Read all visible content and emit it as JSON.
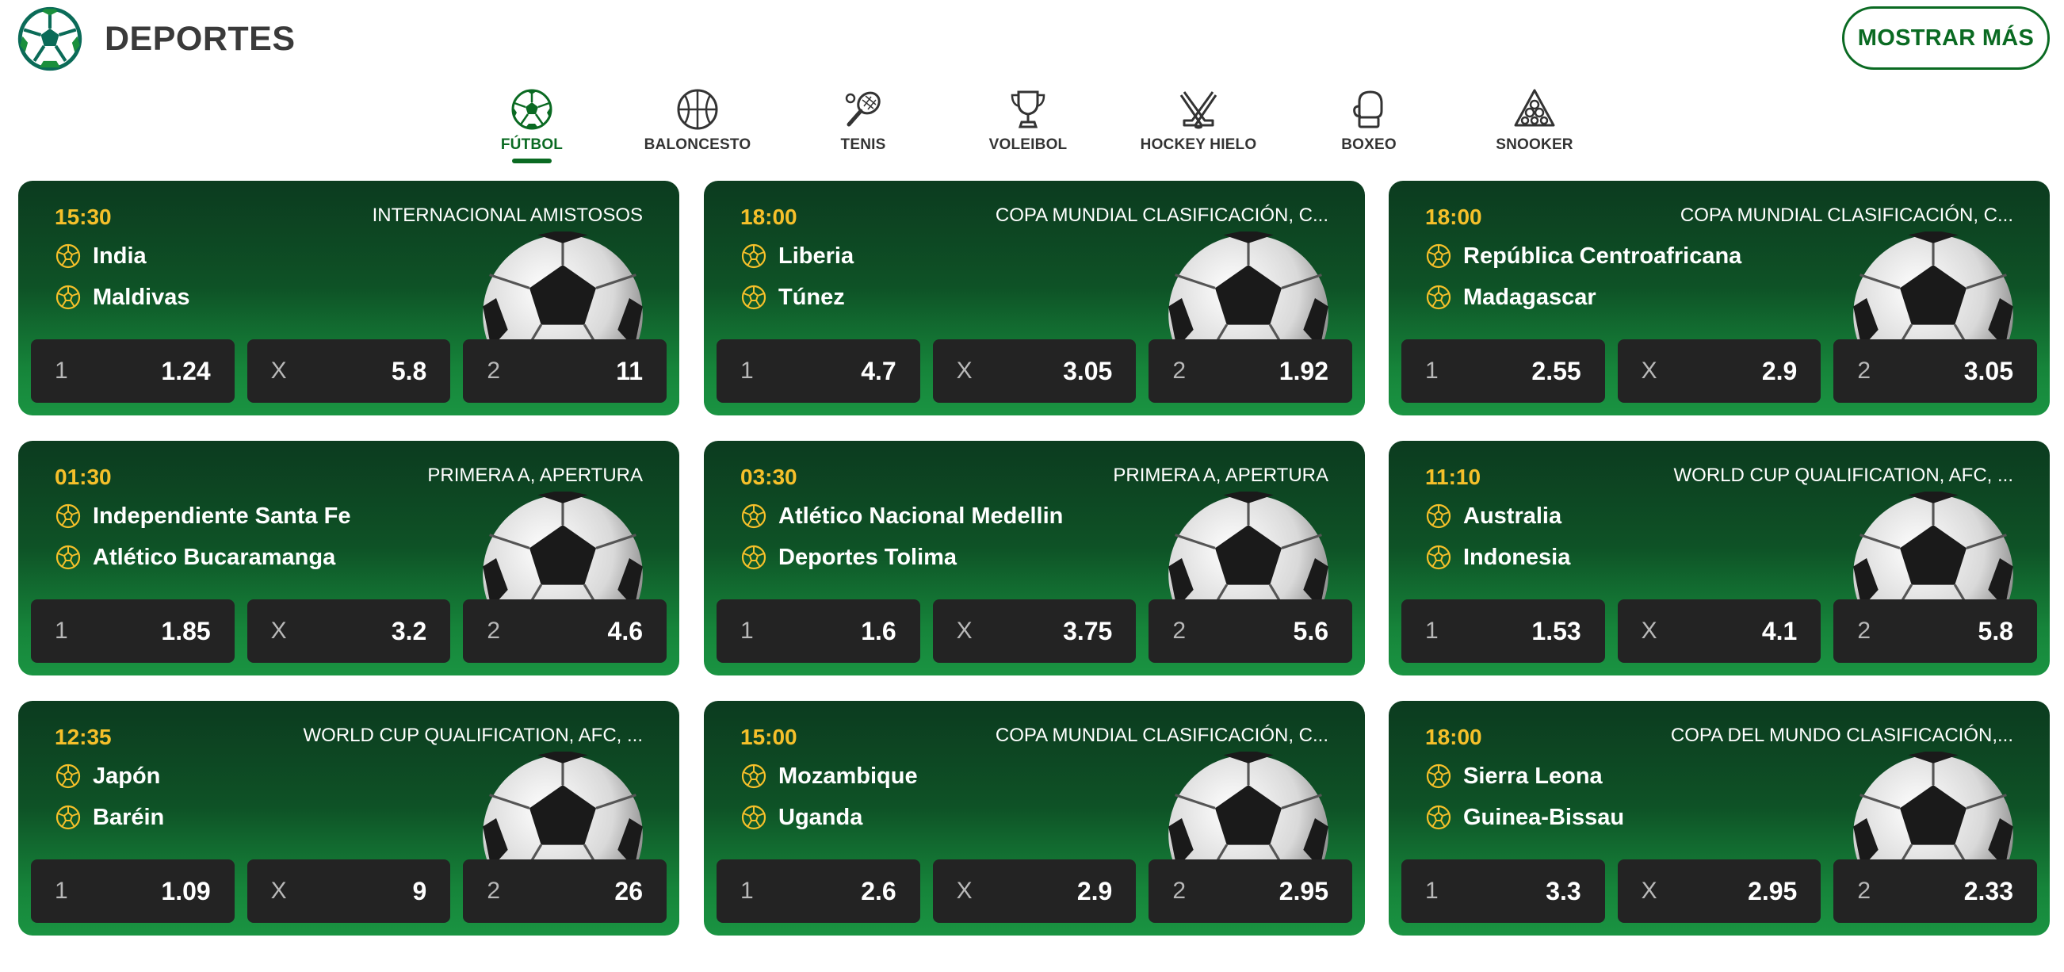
{
  "header": {
    "title": "DEPORTES",
    "more_button": "MOSTRAR MÁS",
    "logo_icon": "soccer-ball-icon"
  },
  "colors": {
    "brand_green": "#0a6a22",
    "time_yellow": "#f5c02a",
    "odds_bg": "#232323"
  },
  "tabs": [
    {
      "label": "FÚTBOL",
      "icon": "soccer-ball-icon",
      "active": true
    },
    {
      "label": "BALONCESTO",
      "icon": "basketball-icon",
      "active": false
    },
    {
      "label": "TENIS",
      "icon": "tennis-racket-icon",
      "active": false
    },
    {
      "label": "VOLEIBOL",
      "icon": "trophy-icon",
      "active": false
    },
    {
      "label": "HOCKEY HIELO",
      "icon": "hockey-sticks-icon",
      "active": false
    },
    {
      "label": "BOXEO",
      "icon": "boxing-glove-icon",
      "active": false
    },
    {
      "label": "SNOOKER",
      "icon": "snooker-balls-icon",
      "active": false
    }
  ],
  "events": [
    {
      "time": "15:30",
      "league": "INTERNACIONAL AMISTOSOS",
      "home": "India",
      "away": "Maldivas",
      "odds": [
        {
          "sel": "1",
          "val": "1.24"
        },
        {
          "sel": "X",
          "val": "5.8"
        },
        {
          "sel": "2",
          "val": "11"
        }
      ]
    },
    {
      "time": "18:00",
      "league": "COPA MUNDIAL CLASIFICACIÓN, C...",
      "home": "Liberia",
      "away": "Túnez",
      "odds": [
        {
          "sel": "1",
          "val": "4.7"
        },
        {
          "sel": "X",
          "val": "3.05"
        },
        {
          "sel": "2",
          "val": "1.92"
        }
      ]
    },
    {
      "time": "18:00",
      "league": "COPA MUNDIAL CLASIFICACIÓN, C...",
      "home": "República Centroafricana",
      "away": "Madagascar",
      "odds": [
        {
          "sel": "1",
          "val": "2.55"
        },
        {
          "sel": "X",
          "val": "2.9"
        },
        {
          "sel": "2",
          "val": "3.05"
        }
      ]
    },
    {
      "time": "01:30",
      "league": "PRIMERA A, APERTURA",
      "home": "Independiente Santa Fe",
      "away": "Atlético Bucaramanga",
      "odds": [
        {
          "sel": "1",
          "val": "1.85"
        },
        {
          "sel": "X",
          "val": "3.2"
        },
        {
          "sel": "2",
          "val": "4.6"
        }
      ]
    },
    {
      "time": "03:30",
      "league": "PRIMERA A, APERTURA",
      "home": "Atlético Nacional Medellin",
      "away": "Deportes Tolima",
      "odds": [
        {
          "sel": "1",
          "val": "1.6"
        },
        {
          "sel": "X",
          "val": "3.75"
        },
        {
          "sel": "2",
          "val": "5.6"
        }
      ]
    },
    {
      "time": "11:10",
      "league": "WORLD CUP QUALIFICATION, AFC, ...",
      "home": "Australia",
      "away": "Indonesia",
      "odds": [
        {
          "sel": "1",
          "val": "1.53"
        },
        {
          "sel": "X",
          "val": "4.1"
        },
        {
          "sel": "2",
          "val": "5.8"
        }
      ]
    },
    {
      "time": "12:35",
      "league": "WORLD CUP QUALIFICATION, AFC, ...",
      "home": "Japón",
      "away": "Baréin",
      "odds": [
        {
          "sel": "1",
          "val": "1.09"
        },
        {
          "sel": "X",
          "val": "9"
        },
        {
          "sel": "2",
          "val": "26"
        }
      ]
    },
    {
      "time": "15:00",
      "league": "COPA MUNDIAL CLASIFICACIÓN, C...",
      "home": "Mozambique",
      "away": "Uganda",
      "odds": [
        {
          "sel": "1",
          "val": "2.6"
        },
        {
          "sel": "X",
          "val": "2.9"
        },
        {
          "sel": "2",
          "val": "2.95"
        }
      ]
    },
    {
      "time": "18:00",
      "league": "COPA DEL MUNDO CLASIFICACIÓN,...",
      "home": "Sierra Leona",
      "away": "Guinea-Bissau",
      "odds": [
        {
          "sel": "1",
          "val": "3.3"
        },
        {
          "sel": "X",
          "val": "2.95"
        },
        {
          "sel": "2",
          "val": "2.33"
        }
      ]
    }
  ]
}
